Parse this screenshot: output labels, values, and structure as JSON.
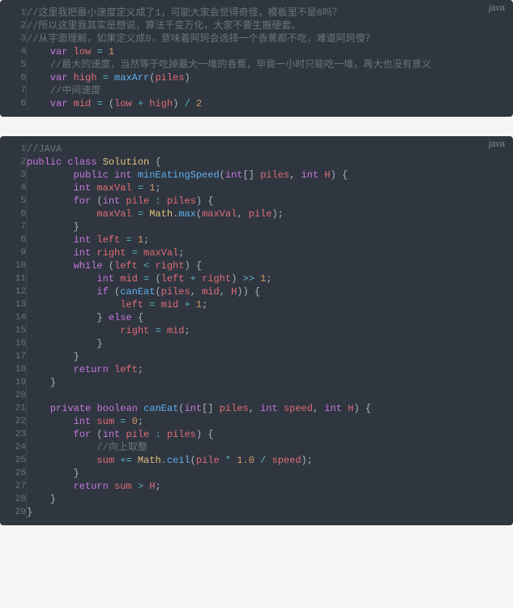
{
  "block1": {
    "lang": "java",
    "lines": [
      [
        [
          "comment",
          "//这里我把最小速度定义成了1，可能大家会觉得奇怪，模板里不是0吗？"
        ]
      ],
      [
        [
          "comment",
          "//所以这里我其实是想说，算法千变万化，大家不要生搬硬套。"
        ]
      ],
      [
        [
          "comment",
          "//从字面理解，如果定义成0，意味着阿珂会选择一个香蕉都不吃，难道阿珂傻？"
        ]
      ],
      [
        [
          "plain",
          "    "
        ],
        [
          "keyword",
          "var"
        ],
        [
          "plain",
          " "
        ],
        [
          "var",
          "low"
        ],
        [
          "plain",
          " "
        ],
        [
          "op",
          "="
        ],
        [
          "plain",
          " "
        ],
        [
          "number",
          "1"
        ]
      ],
      [
        [
          "plain",
          "    "
        ],
        [
          "comment",
          "//最大的速度，当然等于吃掉最大一堆的香蕉，毕竟一小时只能吃一堆，再大也没有意义"
        ]
      ],
      [
        [
          "plain",
          "    "
        ],
        [
          "keyword",
          "var"
        ],
        [
          "plain",
          " "
        ],
        [
          "var",
          "high"
        ],
        [
          "plain",
          " "
        ],
        [
          "op",
          "="
        ],
        [
          "plain",
          " "
        ],
        [
          "func",
          "maxArr"
        ],
        [
          "paren",
          "("
        ],
        [
          "var",
          "piles"
        ],
        [
          "paren",
          ")"
        ]
      ],
      [
        [
          "plain",
          "    "
        ],
        [
          "comment",
          "//中间速度"
        ]
      ],
      [
        [
          "plain",
          "    "
        ],
        [
          "keyword",
          "var"
        ],
        [
          "plain",
          " "
        ],
        [
          "var",
          "mid"
        ],
        [
          "plain",
          " "
        ],
        [
          "op",
          "="
        ],
        [
          "plain",
          " "
        ],
        [
          "paren",
          "("
        ],
        [
          "var",
          "low"
        ],
        [
          "plain",
          " "
        ],
        [
          "op",
          "+"
        ],
        [
          "plain",
          " "
        ],
        [
          "var",
          "high"
        ],
        [
          "paren",
          ")"
        ],
        [
          "plain",
          " "
        ],
        [
          "op",
          "/"
        ],
        [
          "plain",
          " "
        ],
        [
          "number",
          "2"
        ]
      ]
    ]
  },
  "block2": {
    "lang": "java",
    "lines": [
      [
        [
          "comment",
          "//JAVA"
        ]
      ],
      [
        [
          "keyword",
          "public"
        ],
        [
          "plain",
          " "
        ],
        [
          "keyword",
          "class"
        ],
        [
          "plain",
          " "
        ],
        [
          "class",
          "Solution"
        ],
        [
          "plain",
          " "
        ],
        [
          "paren",
          "{"
        ]
      ],
      [
        [
          "plain",
          "        "
        ],
        [
          "keyword",
          "public"
        ],
        [
          "plain",
          " "
        ],
        [
          "type",
          "int"
        ],
        [
          "plain",
          " "
        ],
        [
          "funcdef",
          "minEatingSpeed"
        ],
        [
          "paren",
          "("
        ],
        [
          "type",
          "int"
        ],
        [
          "paren",
          "[]"
        ],
        [
          "plain",
          " "
        ],
        [
          "var",
          "piles"
        ],
        [
          "paren",
          ","
        ],
        [
          "plain",
          " "
        ],
        [
          "type",
          "int"
        ],
        [
          "plain",
          " "
        ],
        [
          "var",
          "H"
        ],
        [
          "paren",
          ")"
        ],
        [
          "plain",
          " "
        ],
        [
          "paren",
          "{"
        ]
      ],
      [
        [
          "plain",
          "        "
        ],
        [
          "type",
          "int"
        ],
        [
          "plain",
          " "
        ],
        [
          "var",
          "maxVal"
        ],
        [
          "plain",
          " "
        ],
        [
          "op",
          "="
        ],
        [
          "plain",
          " "
        ],
        [
          "number",
          "1"
        ],
        [
          "paren",
          ";"
        ]
      ],
      [
        [
          "plain",
          "        "
        ],
        [
          "keyword",
          "for"
        ],
        [
          "plain",
          " "
        ],
        [
          "paren",
          "("
        ],
        [
          "type",
          "int"
        ],
        [
          "plain",
          " "
        ],
        [
          "var",
          "pile"
        ],
        [
          "plain",
          " "
        ],
        [
          "op",
          ":"
        ],
        [
          "plain",
          " "
        ],
        [
          "var",
          "piles"
        ],
        [
          "paren",
          ")"
        ],
        [
          "plain",
          " "
        ],
        [
          "paren",
          "{"
        ]
      ],
      [
        [
          "plain",
          "            "
        ],
        [
          "var",
          "maxVal"
        ],
        [
          "plain",
          " "
        ],
        [
          "op",
          "="
        ],
        [
          "plain",
          " "
        ],
        [
          "builtin",
          "Math"
        ],
        [
          "paren",
          "."
        ],
        [
          "func",
          "max"
        ],
        [
          "paren",
          "("
        ],
        [
          "var",
          "maxVal"
        ],
        [
          "paren",
          ","
        ],
        [
          "plain",
          " "
        ],
        [
          "var",
          "pile"
        ],
        [
          "paren",
          ");"
        ]
      ],
      [
        [
          "plain",
          "        "
        ],
        [
          "paren",
          "}"
        ]
      ],
      [
        [
          "plain",
          "        "
        ],
        [
          "type",
          "int"
        ],
        [
          "plain",
          " "
        ],
        [
          "var",
          "left"
        ],
        [
          "plain",
          " "
        ],
        [
          "op",
          "="
        ],
        [
          "plain",
          " "
        ],
        [
          "number",
          "1"
        ],
        [
          "paren",
          ";"
        ]
      ],
      [
        [
          "plain",
          "        "
        ],
        [
          "type",
          "int"
        ],
        [
          "plain",
          " "
        ],
        [
          "var",
          "right"
        ],
        [
          "plain",
          " "
        ],
        [
          "op",
          "="
        ],
        [
          "plain",
          " "
        ],
        [
          "var",
          "maxVal"
        ],
        [
          "paren",
          ";"
        ]
      ],
      [
        [
          "plain",
          "        "
        ],
        [
          "keyword",
          "while"
        ],
        [
          "plain",
          " "
        ],
        [
          "paren",
          "("
        ],
        [
          "var",
          "left"
        ],
        [
          "plain",
          " "
        ],
        [
          "op",
          "<"
        ],
        [
          "plain",
          " "
        ],
        [
          "var",
          "right"
        ],
        [
          "paren",
          ")"
        ],
        [
          "plain",
          " "
        ],
        [
          "paren",
          "{"
        ]
      ],
      [
        [
          "plain",
          "            "
        ],
        [
          "type",
          "int"
        ],
        [
          "plain",
          " "
        ],
        [
          "var",
          "mid"
        ],
        [
          "plain",
          " "
        ],
        [
          "op",
          "="
        ],
        [
          "plain",
          " "
        ],
        [
          "paren",
          "("
        ],
        [
          "var",
          "left"
        ],
        [
          "plain",
          " "
        ],
        [
          "op",
          "+"
        ],
        [
          "plain",
          " "
        ],
        [
          "var",
          "right"
        ],
        [
          "paren",
          ")"
        ],
        [
          "plain",
          " "
        ],
        [
          "op",
          ">>"
        ],
        [
          "plain",
          " "
        ],
        [
          "number",
          "1"
        ],
        [
          "paren",
          ";"
        ]
      ],
      [
        [
          "plain",
          "            "
        ],
        [
          "keyword",
          "if"
        ],
        [
          "plain",
          " "
        ],
        [
          "paren",
          "("
        ],
        [
          "func",
          "canEat"
        ],
        [
          "paren",
          "("
        ],
        [
          "var",
          "piles"
        ],
        [
          "paren",
          ","
        ],
        [
          "plain",
          " "
        ],
        [
          "var",
          "mid"
        ],
        [
          "paren",
          ","
        ],
        [
          "plain",
          " "
        ],
        [
          "var",
          "H"
        ],
        [
          "paren",
          "))"
        ],
        [
          "plain",
          " "
        ],
        [
          "paren",
          "{"
        ]
      ],
      [
        [
          "plain",
          "                "
        ],
        [
          "var",
          "left"
        ],
        [
          "plain",
          " "
        ],
        [
          "op",
          "="
        ],
        [
          "plain",
          " "
        ],
        [
          "var",
          "mid"
        ],
        [
          "plain",
          " "
        ],
        [
          "op",
          "+"
        ],
        [
          "plain",
          " "
        ],
        [
          "number",
          "1"
        ],
        [
          "paren",
          ";"
        ]
      ],
      [
        [
          "plain",
          "            "
        ],
        [
          "paren",
          "}"
        ],
        [
          "plain",
          " "
        ],
        [
          "keyword",
          "else"
        ],
        [
          "plain",
          " "
        ],
        [
          "paren",
          "{"
        ]
      ],
      [
        [
          "plain",
          "                "
        ],
        [
          "var",
          "right"
        ],
        [
          "plain",
          " "
        ],
        [
          "op",
          "="
        ],
        [
          "plain",
          " "
        ],
        [
          "var",
          "mid"
        ],
        [
          "paren",
          ";"
        ]
      ],
      [
        [
          "plain",
          "            "
        ],
        [
          "paren",
          "}"
        ]
      ],
      [
        [
          "plain",
          "        "
        ],
        [
          "paren",
          "}"
        ]
      ],
      [
        [
          "plain",
          "        "
        ],
        [
          "keyword",
          "return"
        ],
        [
          "plain",
          " "
        ],
        [
          "var",
          "left"
        ],
        [
          "paren",
          ";"
        ]
      ],
      [
        [
          "plain",
          "    "
        ],
        [
          "paren",
          "}"
        ]
      ],
      [
        [
          "plain",
          ""
        ]
      ],
      [
        [
          "plain",
          "    "
        ],
        [
          "keyword",
          "private"
        ],
        [
          "plain",
          " "
        ],
        [
          "type",
          "boolean"
        ],
        [
          "plain",
          " "
        ],
        [
          "funcdef",
          "canEat"
        ],
        [
          "paren",
          "("
        ],
        [
          "type",
          "int"
        ],
        [
          "paren",
          "[]"
        ],
        [
          "plain",
          " "
        ],
        [
          "var",
          "piles"
        ],
        [
          "paren",
          ","
        ],
        [
          "plain",
          " "
        ],
        [
          "type",
          "int"
        ],
        [
          "plain",
          " "
        ],
        [
          "var",
          "speed"
        ],
        [
          "paren",
          ","
        ],
        [
          "plain",
          " "
        ],
        [
          "type",
          "int"
        ],
        [
          "plain",
          " "
        ],
        [
          "var",
          "H"
        ],
        [
          "paren",
          ")"
        ],
        [
          "plain",
          " "
        ],
        [
          "paren",
          "{"
        ]
      ],
      [
        [
          "plain",
          "        "
        ],
        [
          "type",
          "int"
        ],
        [
          "plain",
          " "
        ],
        [
          "var",
          "sum"
        ],
        [
          "plain",
          " "
        ],
        [
          "op",
          "="
        ],
        [
          "plain",
          " "
        ],
        [
          "number",
          "0"
        ],
        [
          "paren",
          ";"
        ]
      ],
      [
        [
          "plain",
          "        "
        ],
        [
          "keyword",
          "for"
        ],
        [
          "plain",
          " "
        ],
        [
          "paren",
          "("
        ],
        [
          "type",
          "int"
        ],
        [
          "plain",
          " "
        ],
        [
          "var",
          "pile"
        ],
        [
          "plain",
          " "
        ],
        [
          "op",
          ":"
        ],
        [
          "plain",
          " "
        ],
        [
          "var",
          "piles"
        ],
        [
          "paren",
          ")"
        ],
        [
          "plain",
          " "
        ],
        [
          "paren",
          "{"
        ]
      ],
      [
        [
          "plain",
          "            "
        ],
        [
          "comment",
          "//向上取整"
        ]
      ],
      [
        [
          "plain",
          "            "
        ],
        [
          "var",
          "sum"
        ],
        [
          "plain",
          " "
        ],
        [
          "op",
          "+="
        ],
        [
          "plain",
          " "
        ],
        [
          "builtin",
          "Math"
        ],
        [
          "paren",
          "."
        ],
        [
          "func",
          "ceil"
        ],
        [
          "paren",
          "("
        ],
        [
          "var",
          "pile"
        ],
        [
          "plain",
          " "
        ],
        [
          "op",
          "*"
        ],
        [
          "plain",
          " "
        ],
        [
          "number",
          "1.0"
        ],
        [
          "plain",
          " "
        ],
        [
          "op",
          "/"
        ],
        [
          "plain",
          " "
        ],
        [
          "var",
          "speed"
        ],
        [
          "paren",
          ");"
        ]
      ],
      [
        [
          "plain",
          "        "
        ],
        [
          "paren",
          "}"
        ]
      ],
      [
        [
          "plain",
          "        "
        ],
        [
          "keyword",
          "return"
        ],
        [
          "plain",
          " "
        ],
        [
          "var",
          "sum"
        ],
        [
          "plain",
          " "
        ],
        [
          "op",
          ">"
        ],
        [
          "plain",
          " "
        ],
        [
          "var",
          "H"
        ],
        [
          "paren",
          ";"
        ]
      ],
      [
        [
          "plain",
          "    "
        ],
        [
          "paren",
          "}"
        ]
      ],
      [
        [
          "paren",
          "}"
        ]
      ]
    ]
  }
}
